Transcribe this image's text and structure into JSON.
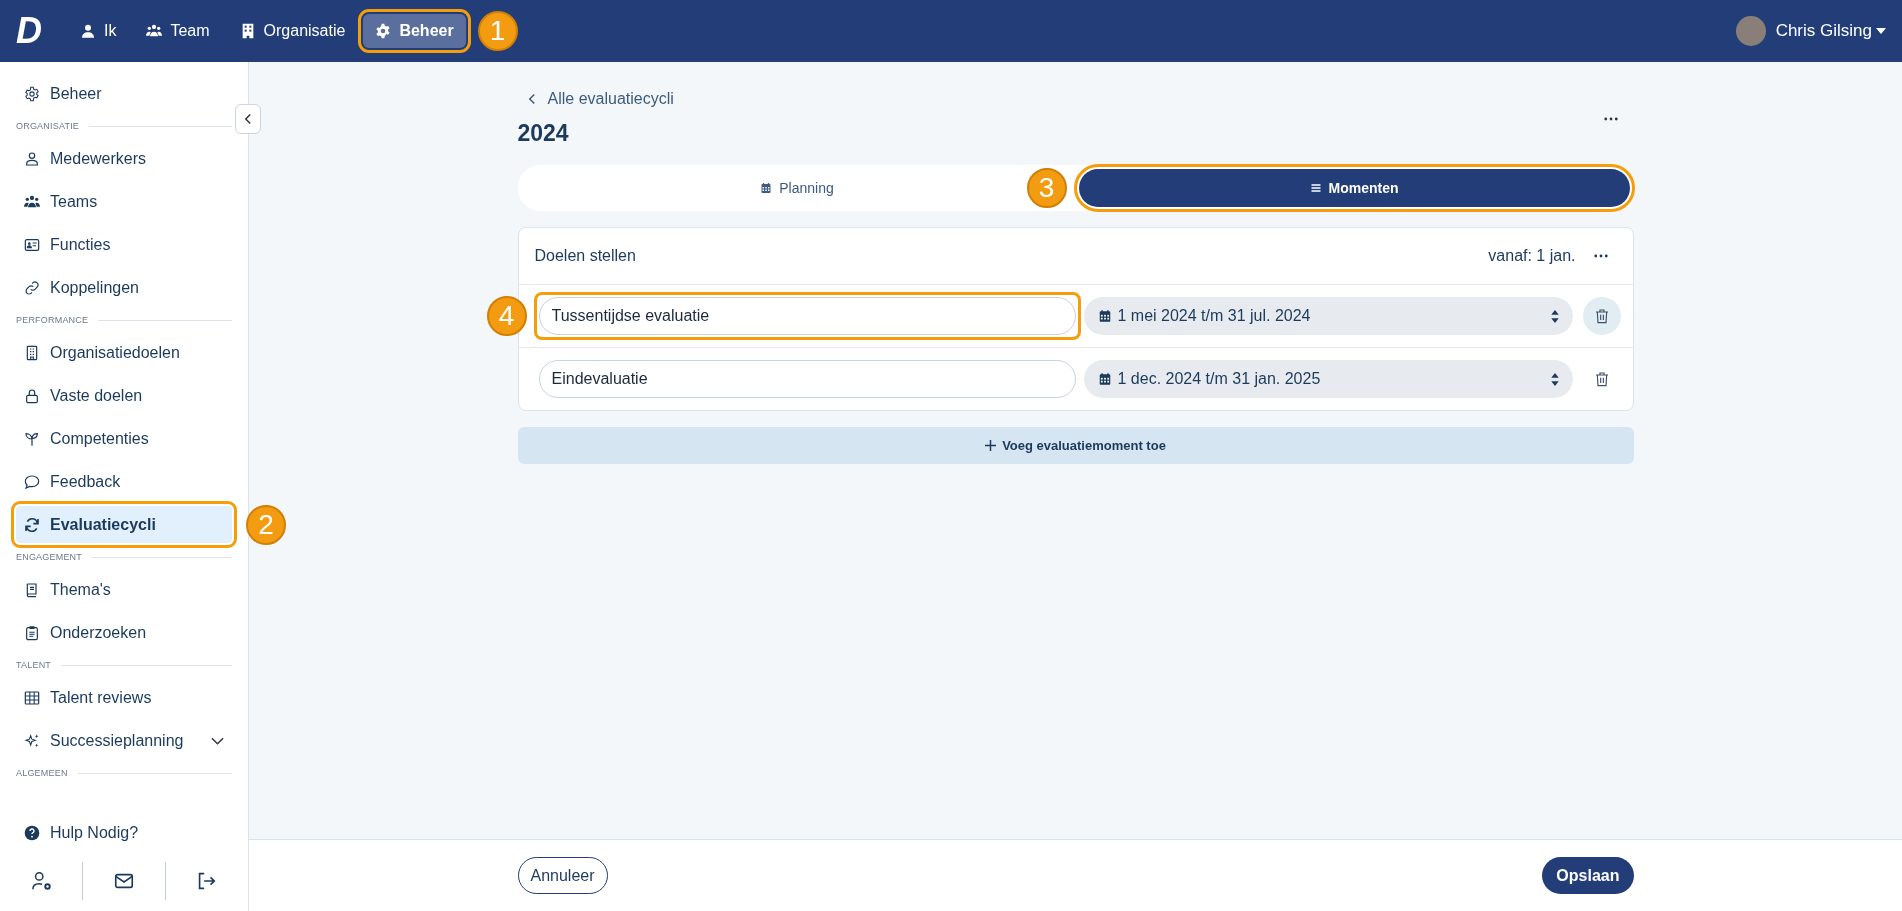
{
  "topbar": {
    "logo": "D",
    "nav": [
      {
        "label": "Ik",
        "selected": false
      },
      {
        "label": "Team",
        "selected": false
      },
      {
        "label": "Organisatie",
        "selected": false
      },
      {
        "label": "Beheer",
        "selected": true,
        "callout": "1"
      }
    ],
    "user": {
      "name": "Chris Gilsing"
    }
  },
  "sidebar": {
    "items": [
      {
        "kind": "item",
        "label": "Beheer",
        "selected": false
      },
      {
        "kind": "section",
        "label": "ORGANISATIE"
      },
      {
        "kind": "item",
        "label": "Medewerkers",
        "selected": false
      },
      {
        "kind": "item",
        "label": "Teams",
        "selected": false
      },
      {
        "kind": "item",
        "label": "Functies",
        "selected": false
      },
      {
        "kind": "item",
        "label": "Koppelingen",
        "selected": false
      },
      {
        "kind": "section",
        "label": "PERFORMANCE"
      },
      {
        "kind": "item",
        "label": "Organisatiedoelen",
        "selected": false
      },
      {
        "kind": "item",
        "label": "Vaste doelen",
        "selected": false
      },
      {
        "kind": "item",
        "label": "Competenties",
        "selected": false
      },
      {
        "kind": "item",
        "label": "Feedback",
        "selected": false
      },
      {
        "kind": "item",
        "label": "Evaluatiecycli",
        "selected": true,
        "callout": "2"
      },
      {
        "kind": "section",
        "label": "ENGAGEMENT"
      },
      {
        "kind": "item",
        "label": "Thema's",
        "selected": false
      },
      {
        "kind": "item",
        "label": "Onderzoeken",
        "selected": false
      },
      {
        "kind": "section",
        "label": "TALENT"
      },
      {
        "kind": "item",
        "label": "Talent reviews",
        "selected": false
      },
      {
        "kind": "item",
        "label": "Successieplanning",
        "selected": false,
        "expanded": false
      },
      {
        "kind": "section",
        "label": "ALGEMEEN"
      }
    ],
    "help": "Hulp Nodig?"
  },
  "back_link": "Alle evaluatiecycli",
  "title": "2024",
  "tabs": [
    {
      "label": "Planning",
      "selected": false
    },
    {
      "label": "Momenten",
      "selected": true,
      "callout": "3"
    }
  ],
  "phase": {
    "title": "Doelen stellen",
    "start": "vanaf: 1 jan.",
    "moments": [
      {
        "name": "Tussentijdse evaluatie",
        "period": "1 mei 2024 t/m 31 jul. 2024",
        "hovered": true,
        "callout": "4"
      },
      {
        "name": "Eindevaluatie",
        "period": "1 dec. 2024 t/m 31 jan. 2025",
        "hovered": false
      }
    ]
  },
  "add_button": "Voeg evaluatiemoment toe",
  "footer": {
    "cancel": "Annuleer",
    "save": "Opslaan"
  }
}
